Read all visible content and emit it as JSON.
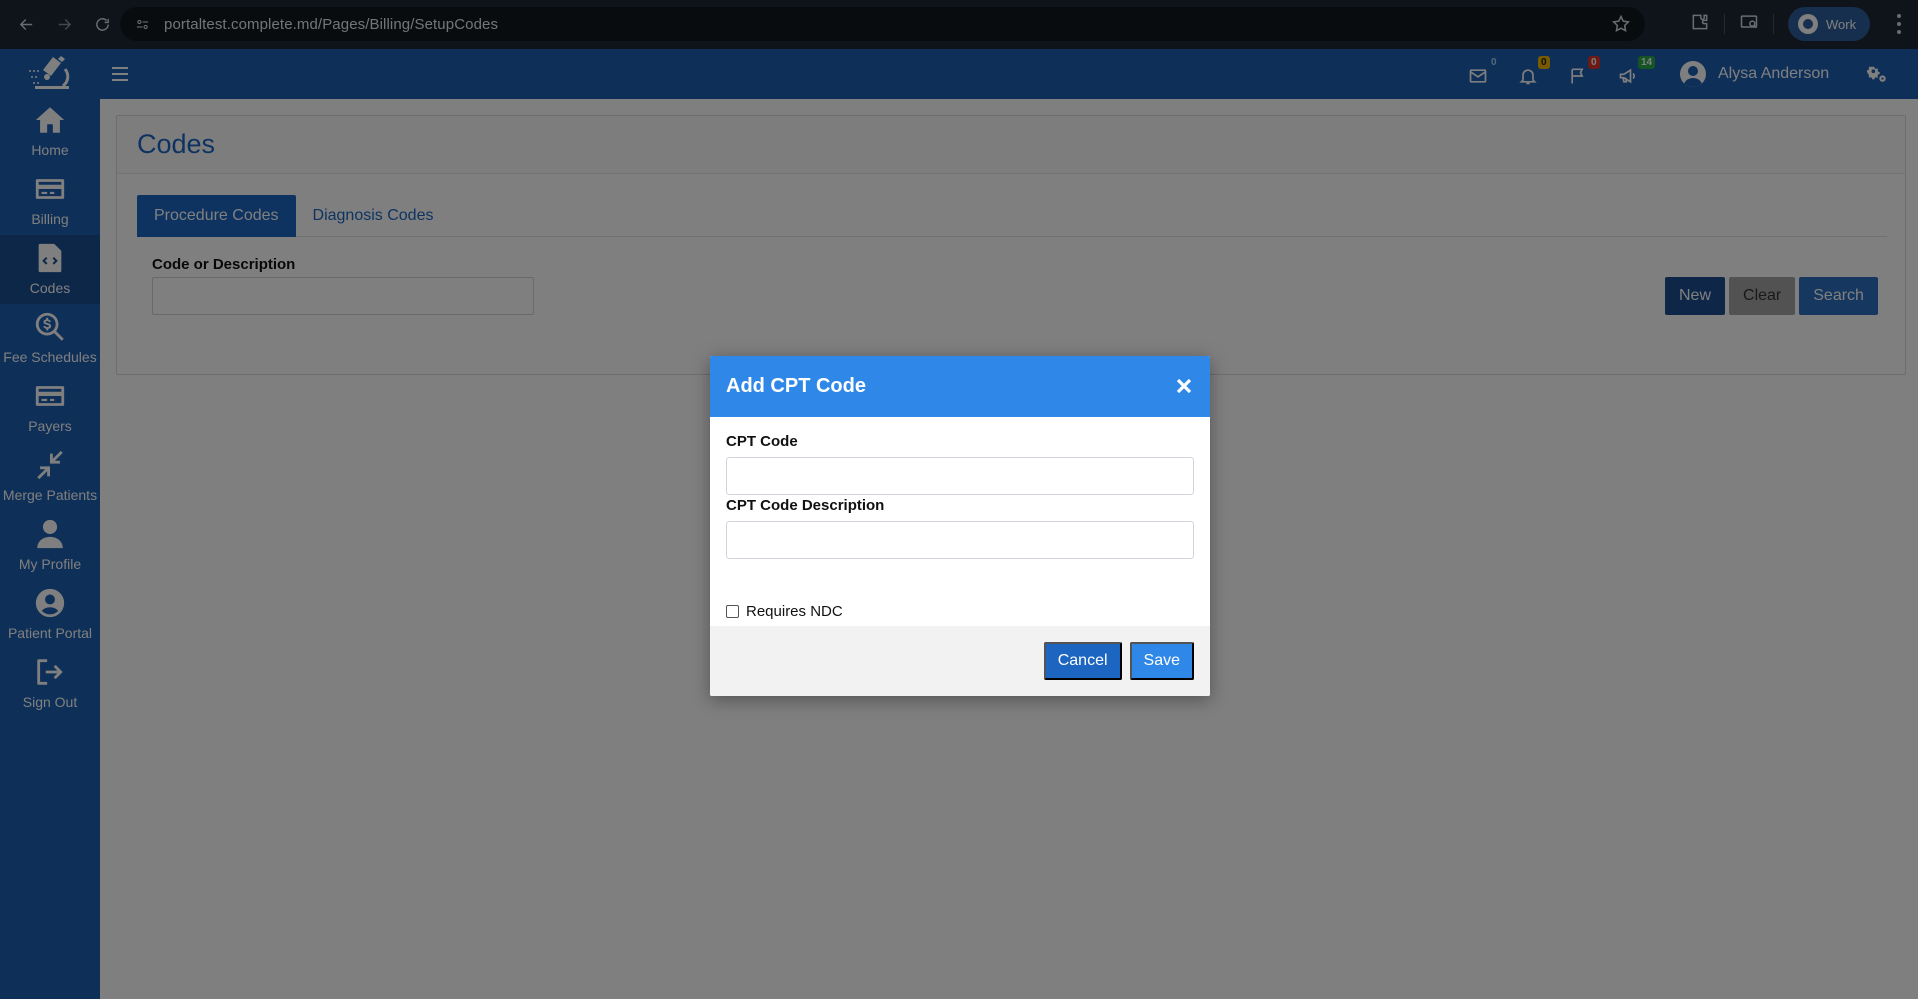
{
  "browser": {
    "url": "portaltest.complete.md/Pages/Billing/SetupCodes",
    "profile_label": "Work"
  },
  "sidebar": {
    "items": [
      {
        "label": "Home",
        "icon": "home-icon"
      },
      {
        "label": "Billing",
        "icon": "credit-card-icon"
      },
      {
        "label": "Codes",
        "icon": "code-file-icon"
      },
      {
        "label": "Fee Schedules",
        "icon": "search-dollar-icon"
      },
      {
        "label": "Payers",
        "icon": "credit-card-icon"
      },
      {
        "label": "Merge Patients",
        "icon": "compress-arrows-icon"
      },
      {
        "label": "My Profile",
        "icon": "user-icon"
      },
      {
        "label": "Patient Portal",
        "icon": "user-circle-icon"
      },
      {
        "label": "Sign Out",
        "icon": "sign-out-icon"
      }
    ],
    "active_item": "Codes"
  },
  "header": {
    "badges": {
      "messages": "0",
      "notifications": "0",
      "flags": "0",
      "announcements": "14"
    },
    "user_name": "Alysa Anderson",
    "colors": {
      "messages_badge": "#1c5fb1",
      "notifications_badge": "#f0b400",
      "flags_badge": "#d9342b",
      "announcements_badge": "#2aa84a"
    }
  },
  "page": {
    "title": "Codes",
    "tabs": [
      {
        "label": "Procedure Codes",
        "active": true
      },
      {
        "label": "Diagnosis Codes",
        "active": false
      }
    ],
    "search_label": "Code or Description",
    "search_value": "",
    "buttons": {
      "new": "New",
      "clear": "Clear",
      "search": "Search"
    }
  },
  "modal": {
    "title": "Add CPT Code",
    "fields": {
      "cpt_code_label": "CPT Code",
      "cpt_code_value": "",
      "description_label": "CPT Code Description",
      "description_value": ""
    },
    "checkbox_label": "Requires NDC",
    "checkbox_checked": false,
    "cancel_label": "Cancel",
    "save_label": "Save"
  }
}
